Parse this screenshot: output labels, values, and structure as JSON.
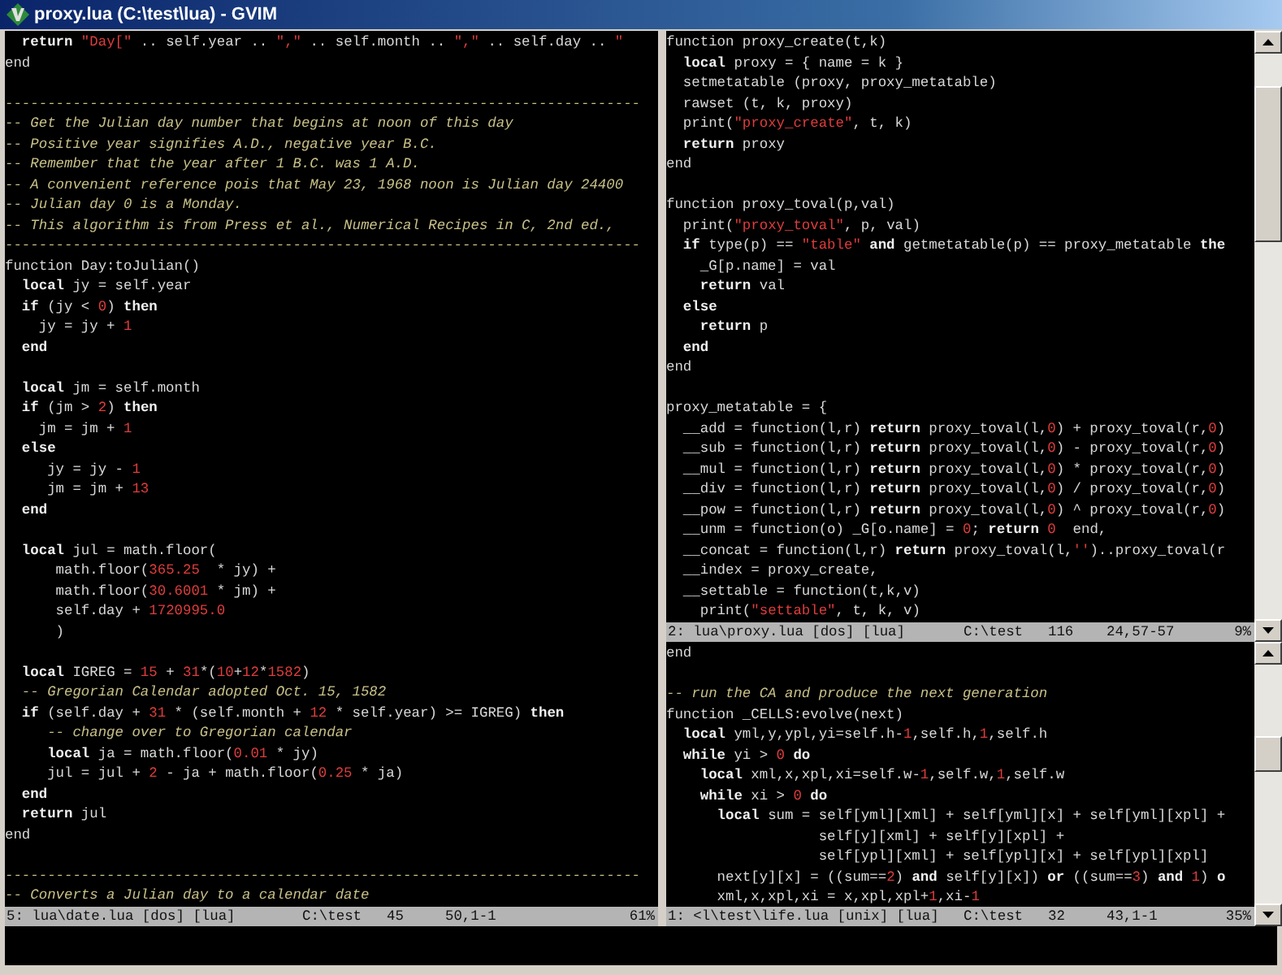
{
  "window": {
    "title": "proxy.lua (C:\\test\\lua) - GVIM"
  },
  "panes": [
    {
      "lines": [
        {
          "kind": "code",
          "tokens": [
            {
              "kind": "keyword",
              "text": "  return"
            },
            {
              "kind": "string",
              "text": " \"Day[\""
            },
            {
              "kind": "plain",
              "text": " .. self.year .. "
            },
            {
              "kind": "string",
              "text": "\",\""
            },
            {
              "kind": "plain",
              "text": " .. self.month .. "
            },
            {
              "kind": "string",
              "text": "\",\""
            },
            {
              "kind": "plain",
              "text": " .. self.day .. "
            },
            {
              "kind": "string",
              "text": "\""
            }
          ]
        },
        {
          "kind": "code",
          "tokens": [
            {
              "kind": "plain",
              "text": "end"
            }
          ]
        },
        {
          "kind": "blank"
        },
        {
          "kind": "code",
          "tokens": [
            {
              "kind": "comment",
              "text": "---------------------------------------------------------------------------"
            }
          ]
        },
        {
          "kind": "code",
          "tokens": [
            {
              "kind": "comment",
              "text": "-- Get the Julian day number that begins at noon of this day"
            }
          ]
        },
        {
          "kind": "code",
          "tokens": [
            {
              "kind": "comment",
              "text": "-- Positive year signifies A.D., negative year B.C."
            }
          ]
        },
        {
          "kind": "code",
          "tokens": [
            {
              "kind": "comment",
              "text": "-- Remember that the year after 1 B.C. was 1 A.D."
            }
          ]
        },
        {
          "kind": "code",
          "tokens": [
            {
              "kind": "comment",
              "text": "-- A convenient reference pois that May 23, 1968 noon is Julian day 24400"
            }
          ]
        },
        {
          "kind": "code",
          "tokens": [
            {
              "kind": "comment",
              "text": "-- Julian day 0 is a Monday."
            }
          ]
        },
        {
          "kind": "code",
          "tokens": [
            {
              "kind": "comment",
              "text": "-- This algorithm is from Press et al., Numerical Recipes in C, 2nd ed.,"
            }
          ]
        },
        {
          "kind": "code",
          "tokens": [
            {
              "kind": "comment",
              "text": "---------------------------------------------------------------------------"
            }
          ]
        },
        {
          "kind": "code",
          "tokens": [
            {
              "kind": "plain",
              "text": "function Day:toJulian()"
            }
          ]
        },
        {
          "kind": "code",
          "tokens": [
            {
              "kind": "keyword",
              "text": "  local"
            },
            {
              "kind": "plain",
              "text": " jy = self.year"
            }
          ]
        },
        {
          "kind": "code",
          "tokens": [
            {
              "kind": "keyword",
              "text": "  if"
            },
            {
              "kind": "plain",
              "text": " (jy < "
            },
            {
              "kind": "number",
              "text": "0"
            },
            {
              "kind": "plain",
              "text": ") "
            },
            {
              "kind": "keyword",
              "text": "then"
            }
          ]
        },
        {
          "kind": "code",
          "tokens": [
            {
              "kind": "plain",
              "text": "    jy = jy + "
            },
            {
              "kind": "number",
              "text": "1"
            }
          ]
        },
        {
          "kind": "code",
          "tokens": [
            {
              "kind": "keyword",
              "text": "  end"
            }
          ]
        },
        {
          "kind": "blank"
        },
        {
          "kind": "code",
          "tokens": [
            {
              "kind": "keyword",
              "text": "  local"
            },
            {
              "kind": "plain",
              "text": " jm = self.month"
            }
          ]
        },
        {
          "kind": "code",
          "tokens": [
            {
              "kind": "keyword",
              "text": "  if"
            },
            {
              "kind": "plain",
              "text": " (jm > "
            },
            {
              "kind": "number",
              "text": "2"
            },
            {
              "kind": "plain",
              "text": ") "
            },
            {
              "kind": "keyword",
              "text": "then"
            }
          ]
        },
        {
          "kind": "code",
          "tokens": [
            {
              "kind": "plain",
              "text": "    jm = jm + "
            },
            {
              "kind": "number",
              "text": "1"
            }
          ]
        },
        {
          "kind": "code",
          "tokens": [
            {
              "kind": "keyword",
              "text": "  else"
            }
          ]
        },
        {
          "kind": "code",
          "tokens": [
            {
              "kind": "plain",
              "text": "     jy = jy - "
            },
            {
              "kind": "number",
              "text": "1"
            }
          ]
        },
        {
          "kind": "code",
          "tokens": [
            {
              "kind": "plain",
              "text": "     jm = jm + "
            },
            {
              "kind": "number",
              "text": "13"
            }
          ]
        },
        {
          "kind": "code",
          "tokens": [
            {
              "kind": "keyword",
              "text": "  end"
            }
          ]
        },
        {
          "kind": "blank"
        },
        {
          "kind": "code",
          "tokens": [
            {
              "kind": "keyword",
              "text": "  local"
            },
            {
              "kind": "plain",
              "text": " jul = math.floor("
            }
          ]
        },
        {
          "kind": "code",
          "tokens": [
            {
              "kind": "plain",
              "text": "      math.floor("
            },
            {
              "kind": "number",
              "text": "365.25"
            },
            {
              "kind": "plain",
              "text": "  * jy) +"
            }
          ]
        },
        {
          "kind": "code",
          "tokens": [
            {
              "kind": "plain",
              "text": "      math.floor("
            },
            {
              "kind": "number",
              "text": "30.6001"
            },
            {
              "kind": "plain",
              "text": " * jm) +"
            }
          ]
        },
        {
          "kind": "code",
          "tokens": [
            {
              "kind": "plain",
              "text": "      self.day + "
            },
            {
              "kind": "number",
              "text": "1720995.0"
            }
          ]
        },
        {
          "kind": "code",
          "tokens": [
            {
              "kind": "plain",
              "text": "      )"
            }
          ]
        },
        {
          "kind": "blank"
        },
        {
          "kind": "code",
          "tokens": [
            {
              "kind": "keyword",
              "text": "  local"
            },
            {
              "kind": "plain",
              "text": " IGREG = "
            },
            {
              "kind": "number",
              "text": "15"
            },
            {
              "kind": "plain",
              "text": " + "
            },
            {
              "kind": "number",
              "text": "31"
            },
            {
              "kind": "plain",
              "text": "*("
            },
            {
              "kind": "number",
              "text": "10"
            },
            {
              "kind": "plain",
              "text": "+"
            },
            {
              "kind": "number",
              "text": "12"
            },
            {
              "kind": "plain",
              "text": "*"
            },
            {
              "kind": "number",
              "text": "1582"
            },
            {
              "kind": "plain",
              "text": ")"
            }
          ]
        },
        {
          "kind": "code",
          "tokens": [
            {
              "kind": "comment",
              "text": "  -- Gregorian Calendar adopted Oct. 15, 1582"
            }
          ]
        },
        {
          "kind": "code",
          "tokens": [
            {
              "kind": "keyword",
              "text": "  if"
            },
            {
              "kind": "plain",
              "text": " (self.day + "
            },
            {
              "kind": "number",
              "text": "31"
            },
            {
              "kind": "plain",
              "text": " * (self.month + "
            },
            {
              "kind": "number",
              "text": "12"
            },
            {
              "kind": "plain",
              "text": " * self.year) >= IGREG) "
            },
            {
              "kind": "keyword",
              "text": "then"
            }
          ]
        },
        {
          "kind": "code",
          "tokens": [
            {
              "kind": "comment",
              "text": "     -- change over to Gregorian calendar"
            }
          ]
        },
        {
          "kind": "code",
          "tokens": [
            {
              "kind": "keyword",
              "text": "     local"
            },
            {
              "kind": "plain",
              "text": " ja = math.floor("
            },
            {
              "kind": "number",
              "text": "0.01"
            },
            {
              "kind": "plain",
              "text": " * jy)"
            }
          ]
        },
        {
          "kind": "code",
          "tokens": [
            {
              "kind": "plain",
              "text": "     jul = jul + "
            },
            {
              "kind": "number",
              "text": "2"
            },
            {
              "kind": "plain",
              "text": " - ja + math.floor("
            },
            {
              "kind": "number",
              "text": "0.25"
            },
            {
              "kind": "plain",
              "text": " * ja)"
            }
          ]
        },
        {
          "kind": "code",
          "tokens": [
            {
              "kind": "keyword",
              "text": "  end"
            }
          ]
        },
        {
          "kind": "code",
          "tokens": [
            {
              "kind": "keyword",
              "text": "  return"
            },
            {
              "kind": "plain",
              "text": " jul"
            }
          ]
        },
        {
          "kind": "code",
          "tokens": [
            {
              "kind": "plain",
              "text": "end"
            }
          ]
        },
        {
          "kind": "blank"
        },
        {
          "kind": "code",
          "tokens": [
            {
              "kind": "comment",
              "text": "---------------------------------------------------------------------------"
            }
          ]
        },
        {
          "kind": "code",
          "tokens": [
            {
              "kind": "comment",
              "text": "-- Converts a Julian day to a calendar date"
            }
          ]
        }
      ],
      "status": {
        "file": "5: lua\\date.lua [dos] [lua]",
        "directory": "C:\\test",
        "lines": "45",
        "position": "50,1-1",
        "percent": "61%"
      }
    },
    {
      "lines": [
        {
          "kind": "code",
          "tokens": [
            {
              "kind": "plain",
              "text": "function proxy_create(t,k)"
            }
          ]
        },
        {
          "kind": "code",
          "tokens": [
            {
              "kind": "keyword",
              "text": "  local"
            },
            {
              "kind": "plain",
              "text": " proxy = { name = k }"
            }
          ]
        },
        {
          "kind": "code",
          "tokens": [
            {
              "kind": "plain",
              "text": "  setmetatable (proxy, proxy_metatable)"
            }
          ]
        },
        {
          "kind": "code",
          "tokens": [
            {
              "kind": "plain",
              "text": "  rawset (t, k, proxy)"
            }
          ]
        },
        {
          "kind": "code",
          "tokens": [
            {
              "kind": "plain",
              "text": "  print("
            },
            {
              "kind": "string",
              "text": "\"proxy_create\""
            },
            {
              "kind": "plain",
              "text": ", t, k)"
            }
          ]
        },
        {
          "kind": "code",
          "tokens": [
            {
              "kind": "keyword",
              "text": "  return"
            },
            {
              "kind": "plain",
              "text": " proxy"
            }
          ]
        },
        {
          "kind": "code",
          "tokens": [
            {
              "kind": "plain",
              "text": "end"
            }
          ]
        },
        {
          "kind": "blank"
        },
        {
          "kind": "code",
          "tokens": [
            {
              "kind": "plain",
              "text": "function proxy_toval(p,val)"
            }
          ]
        },
        {
          "kind": "code",
          "tokens": [
            {
              "kind": "plain",
              "text": "  print("
            },
            {
              "kind": "string",
              "text": "\"proxy_toval\""
            },
            {
              "kind": "plain",
              "text": ", p, val)"
            }
          ]
        },
        {
          "kind": "code",
          "tokens": [
            {
              "kind": "keyword",
              "text": "  if"
            },
            {
              "kind": "plain",
              "text": " type(p) == "
            },
            {
              "kind": "string",
              "text": "\"table\""
            },
            {
              "kind": "keyword",
              "text": " and"
            },
            {
              "kind": "plain",
              "text": " getmetatable(p) == proxy_metatable "
            },
            {
              "kind": "keyword",
              "text": "the"
            }
          ]
        },
        {
          "kind": "code",
          "tokens": [
            {
              "kind": "plain",
              "text": "    _G[p.name] = val"
            }
          ]
        },
        {
          "kind": "code",
          "tokens": [
            {
              "kind": "keyword",
              "text": "    return"
            },
            {
              "kind": "plain",
              "text": " val"
            }
          ]
        },
        {
          "kind": "code",
          "tokens": [
            {
              "kind": "keyword",
              "text": "  else"
            }
          ]
        },
        {
          "kind": "code",
          "tokens": [
            {
              "kind": "keyword",
              "text": "    return"
            },
            {
              "kind": "plain",
              "text": " p"
            }
          ]
        },
        {
          "kind": "code",
          "tokens": [
            {
              "kind": "keyword",
              "text": "  end"
            }
          ]
        },
        {
          "kind": "code",
          "tokens": [
            {
              "kind": "plain",
              "text": "end"
            }
          ]
        },
        {
          "kind": "blank"
        },
        {
          "kind": "code",
          "tokens": [
            {
              "kind": "plain",
              "text": "proxy_metatable = {"
            }
          ]
        },
        {
          "kind": "code",
          "tokens": [
            {
              "kind": "plain",
              "text": "  __add = function(l,r) "
            },
            {
              "kind": "keyword",
              "text": "return"
            },
            {
              "kind": "plain",
              "text": " proxy_toval(l,"
            },
            {
              "kind": "number",
              "text": "0"
            },
            {
              "kind": "plain",
              "text": ") + proxy_toval(r,"
            },
            {
              "kind": "number",
              "text": "0"
            },
            {
              "kind": "plain",
              "text": ")"
            }
          ]
        },
        {
          "kind": "code",
          "tokens": [
            {
              "kind": "plain",
              "text": "  __sub = function(l,r) "
            },
            {
              "kind": "keyword",
              "text": "return"
            },
            {
              "kind": "plain",
              "text": " proxy_toval(l,"
            },
            {
              "kind": "number",
              "text": "0"
            },
            {
              "kind": "plain",
              "text": ") - proxy_toval(r,"
            },
            {
              "kind": "number",
              "text": "0"
            },
            {
              "kind": "plain",
              "text": ")"
            }
          ]
        },
        {
          "kind": "code",
          "tokens": [
            {
              "kind": "plain",
              "text": "  __mul = function(l,r) "
            },
            {
              "kind": "keyword",
              "text": "return"
            },
            {
              "kind": "plain",
              "text": " proxy_toval(l,"
            },
            {
              "kind": "number",
              "text": "0"
            },
            {
              "kind": "plain",
              "text": ") * proxy_toval(r,"
            },
            {
              "kind": "number",
              "text": "0"
            },
            {
              "kind": "plain",
              "text": ")"
            }
          ]
        },
        {
          "kind": "code",
          "tokens": [
            {
              "kind": "plain",
              "text": "  __div = function(l,r) "
            },
            {
              "kind": "keyword",
              "text": "return"
            },
            {
              "kind": "plain",
              "text": " proxy_toval(l,"
            },
            {
              "kind": "number",
              "text": "0"
            },
            {
              "kind": "plain",
              "text": ") / proxy_toval(r,"
            },
            {
              "kind": "number",
              "text": "0"
            },
            {
              "kind": "plain",
              "text": ")"
            }
          ]
        },
        {
          "kind": "code",
          "tokens": [
            {
              "kind": "plain",
              "text": "  __pow = function(l,r) "
            },
            {
              "kind": "keyword",
              "text": "return"
            },
            {
              "kind": "plain",
              "text": " proxy_toval(l,"
            },
            {
              "kind": "number",
              "text": "0"
            },
            {
              "kind": "plain",
              "text": ") ^ proxy_toval(r,"
            },
            {
              "kind": "number",
              "text": "0"
            },
            {
              "kind": "plain",
              "text": ")"
            }
          ]
        },
        {
          "kind": "code",
          "tokens": [
            {
              "kind": "plain",
              "text": "  __unm = function(o) _G[o.name] = "
            },
            {
              "kind": "number",
              "text": "0"
            },
            {
              "kind": "plain",
              "text": "; "
            },
            {
              "kind": "keyword",
              "text": "return"
            },
            {
              "kind": "number",
              "text": " 0"
            },
            {
              "kind": "plain",
              "text": "  end,"
            }
          ]
        },
        {
          "kind": "code",
          "tokens": [
            {
              "kind": "plain",
              "text": "  __concat = function(l,r) "
            },
            {
              "kind": "keyword",
              "text": "return"
            },
            {
              "kind": "plain",
              "text": " proxy_toval(l,"
            },
            {
              "kind": "string",
              "text": "''"
            },
            {
              "kind": "plain",
              "text": ")..proxy_toval(r"
            }
          ]
        },
        {
          "kind": "code",
          "tokens": [
            {
              "kind": "plain",
              "text": "  __index = proxy_create,"
            }
          ]
        },
        {
          "kind": "code",
          "tokens": [
            {
              "kind": "plain",
              "text": "  __settable = function(t,k,v)"
            }
          ]
        },
        {
          "kind": "code",
          "tokens": [
            {
              "kind": "plain",
              "text": "    print("
            },
            {
              "kind": "string",
              "text": "\"settable\""
            },
            {
              "kind": "plain",
              "text": ", t, k, v)"
            }
          ]
        }
      ],
      "status": {
        "file": "2: lua\\proxy.lua [dos] [lua]",
        "directory": "C:\\test",
        "lines": "116",
        "position": "24,57-57",
        "percent": "9%"
      }
    },
    {
      "lines": [
        {
          "kind": "code",
          "tokens": [
            {
              "kind": "plain",
              "text": "end"
            }
          ]
        },
        {
          "kind": "blank"
        },
        {
          "kind": "code",
          "tokens": [
            {
              "kind": "comment",
              "text": "-- run the CA and produce the next generation"
            }
          ]
        },
        {
          "kind": "code",
          "tokens": [
            {
              "kind": "plain",
              "text": "function _CELLS:evolve(next)"
            }
          ]
        },
        {
          "kind": "code",
          "tokens": [
            {
              "kind": "keyword",
              "text": "  local"
            },
            {
              "kind": "plain",
              "text": " yml,y,ypl,yi=self.h-"
            },
            {
              "kind": "number",
              "text": "1"
            },
            {
              "kind": "plain",
              "text": ",self.h,"
            },
            {
              "kind": "number",
              "text": "1"
            },
            {
              "kind": "plain",
              "text": ",self.h"
            }
          ]
        },
        {
          "kind": "code",
          "tokens": [
            {
              "kind": "keyword",
              "text": "  while"
            },
            {
              "kind": "plain",
              "text": " yi > "
            },
            {
              "kind": "number",
              "text": "0"
            },
            {
              "kind": "keyword",
              "text": " do"
            }
          ]
        },
        {
          "kind": "code",
          "tokens": [
            {
              "kind": "keyword",
              "text": "    local"
            },
            {
              "kind": "plain",
              "text": " xml,x,xpl,xi=self.w-"
            },
            {
              "kind": "number",
              "text": "1"
            },
            {
              "kind": "plain",
              "text": ",self.w,"
            },
            {
              "kind": "number",
              "text": "1"
            },
            {
              "kind": "plain",
              "text": ",self.w"
            }
          ]
        },
        {
          "kind": "code",
          "tokens": [
            {
              "kind": "keyword",
              "text": "    while"
            },
            {
              "kind": "plain",
              "text": " xi > "
            },
            {
              "kind": "number",
              "text": "0"
            },
            {
              "kind": "keyword",
              "text": " do"
            }
          ]
        },
        {
          "kind": "code",
          "tokens": [
            {
              "kind": "keyword",
              "text": "      local"
            },
            {
              "kind": "plain",
              "text": " sum = self[yml][xml] + self[yml][x] + self[yml][xpl] +"
            }
          ]
        },
        {
          "kind": "code",
          "tokens": [
            {
              "kind": "plain",
              "text": "                  self[y][xml] + self[y][xpl] +"
            }
          ]
        },
        {
          "kind": "code",
          "tokens": [
            {
              "kind": "plain",
              "text": "                  self[ypl][xml] + self[ypl][x] + self[ypl][xpl]"
            }
          ]
        },
        {
          "kind": "code",
          "tokens": [
            {
              "kind": "plain",
              "text": "      next[y][x] = ((sum=="
            },
            {
              "kind": "number",
              "text": "2"
            },
            {
              "kind": "plain",
              "text": ") "
            },
            {
              "kind": "keyword",
              "text": "and"
            },
            {
              "kind": "plain",
              "text": " self[y][x]) "
            },
            {
              "kind": "keyword",
              "text": "or"
            },
            {
              "kind": "plain",
              "text": " ((sum=="
            },
            {
              "kind": "number",
              "text": "3"
            },
            {
              "kind": "plain",
              "text": ") "
            },
            {
              "kind": "keyword",
              "text": "and"
            },
            {
              "kind": "number",
              "text": " 1"
            },
            {
              "kind": "plain",
              "text": ") "
            },
            {
              "kind": "keyword",
              "text": "o"
            }
          ]
        },
        {
          "kind": "code",
          "tokens": [
            {
              "kind": "plain",
              "text": "      xml,x,xpl,xi = x,xpl,xpl+"
            },
            {
              "kind": "number",
              "text": "1"
            },
            {
              "kind": "plain",
              "text": ",xi-"
            },
            {
              "kind": "number",
              "text": "1"
            }
          ]
        }
      ],
      "status": {
        "file": "1: <l\\test\\life.lua [unix] [lua]",
        "directory": "C:\\test",
        "lines": "32",
        "position": "43,1-1",
        "percent": "35%"
      }
    }
  ]
}
